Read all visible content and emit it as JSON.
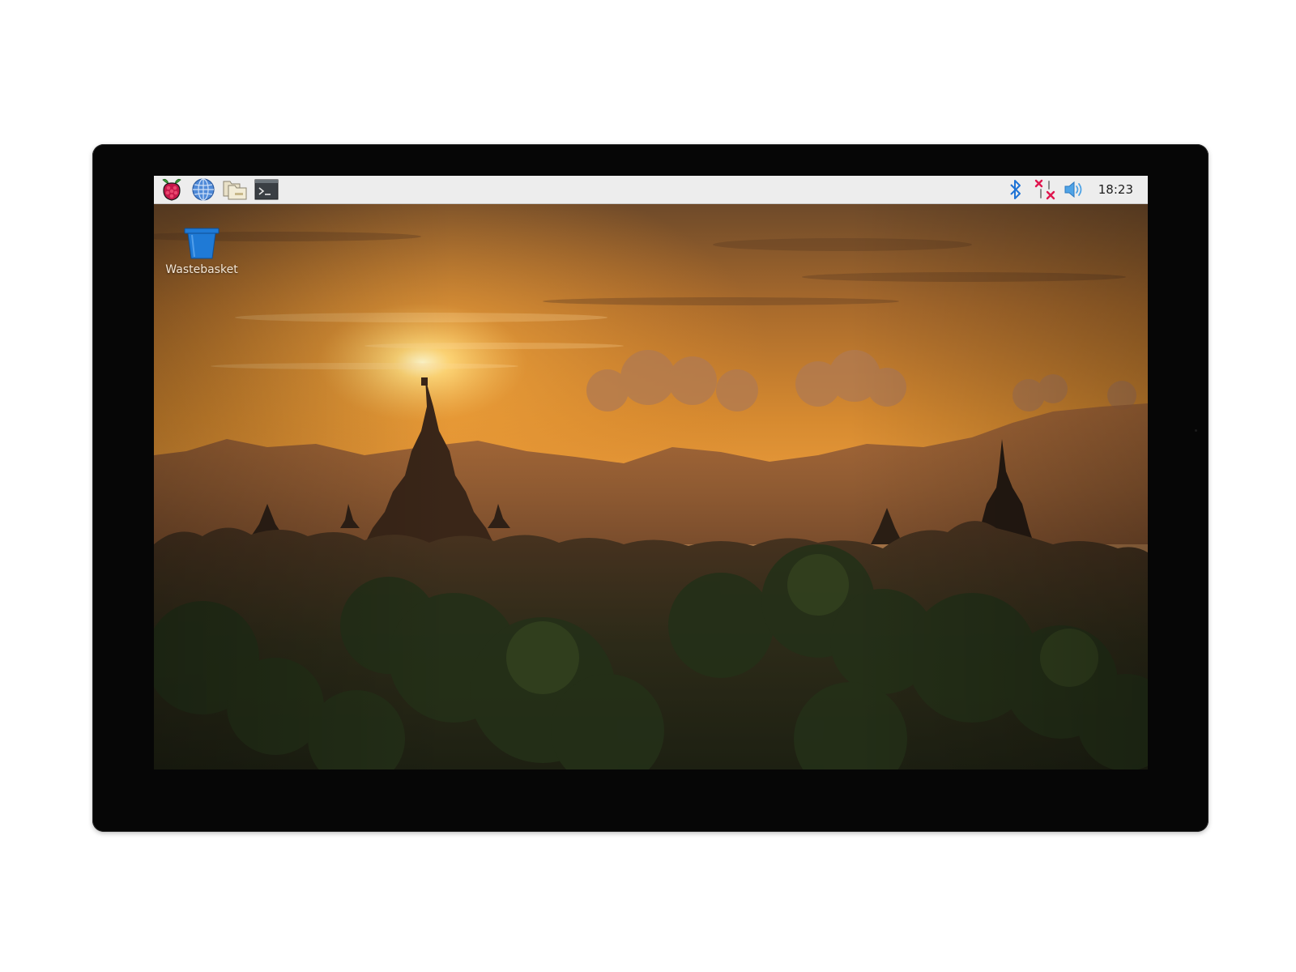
{
  "taskbar": {
    "menu_icon": "raspberry-icon",
    "launchers": [
      {
        "name": "web-browser",
        "icon": "globe-icon"
      },
      {
        "name": "file-manager",
        "icon": "folders-icon"
      },
      {
        "name": "terminal",
        "icon": "terminal-icon"
      }
    ],
    "tray": {
      "bluetooth_icon": "bluetooth-icon",
      "network_icon": "network-disconnected-icon",
      "volume_icon": "volume-icon",
      "clock": "18:23"
    }
  },
  "desktop": {
    "icons": [
      {
        "label": "Wastebasket",
        "icon": "wastebasket-icon"
      }
    ]
  },
  "colors": {
    "taskbar_bg": "#ededed",
    "bluetooth": "#1e73d6",
    "network_error": "#e0164f",
    "wastebasket": "#1f7ad6"
  }
}
